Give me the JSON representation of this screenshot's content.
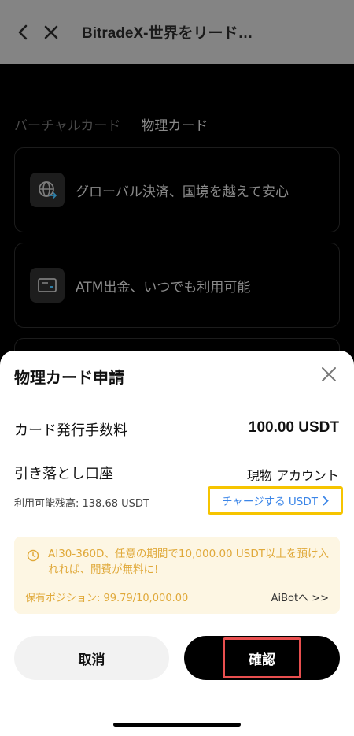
{
  "nav": {
    "title": "BitradeX-世界をリード…"
  },
  "background": {
    "tabs": [
      {
        "label": "バーチャルカード"
      },
      {
        "label": "物理カード"
      }
    ],
    "features": [
      {
        "text": "グローバル決済、国境を越えて安心"
      },
      {
        "text": "ATM出金、いつでも利用可能"
      }
    ]
  },
  "sheet": {
    "title": "物理カード申請",
    "fee_label": "カード発行手数料",
    "fee_value": "100.00 USDT",
    "account_label": "引き落とし口座",
    "account_value": "現物 アカウント",
    "balance_text": "利用可能残高: 138.68 USDT",
    "charge_link": "チャージする USDT",
    "promo": {
      "text": "AI30-360D、任意の期間で10,000.00 USDT以上を預け入れれば、開費が無料に!",
      "position": "保有ポジション: 99.79/10,000.00",
      "aibot_link": "AiBotへ >>"
    },
    "cancel_label": "取消",
    "confirm_label": "確認"
  },
  "colors": {
    "accent_link": "#3c86e8",
    "promo_text": "#e0a93a",
    "promo_bg": "#fdf6e3",
    "highlight_yellow": "#f6c400",
    "highlight_red": "#e84f4f"
  }
}
